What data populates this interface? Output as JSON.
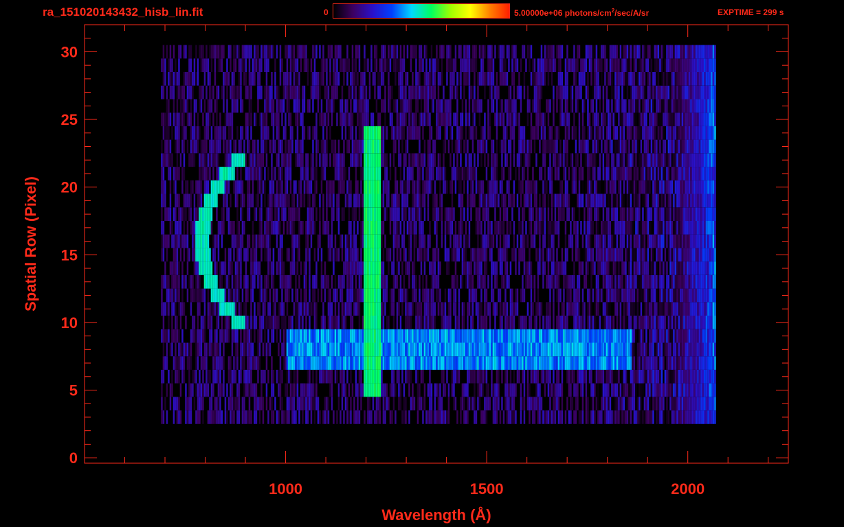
{
  "header": {
    "title": "ra_151020143432_hisb_lin.fit",
    "colorbar_min": "0",
    "colorbar_max_prefix": "5.00000e+06 photons/cm",
    "colorbar_max_exp": "2",
    "colorbar_max_suffix": "/sec/A/sr",
    "exptime": "EXPTIME = 299 s"
  },
  "colors": {
    "axis": "#ff2a1a",
    "background": "#000000",
    "colormap": [
      "#000000",
      "#3c0060",
      "#2a10c8",
      "#0040ff",
      "#00d8ff",
      "#00ff60",
      "#a0ff00",
      "#ffff00",
      "#ff8000",
      "#ff2000"
    ]
  },
  "chart_data": {
    "type": "heatmap",
    "xlabel": "Wavelength (Å)",
    "ylabel": "Spatial Row (Pixel)",
    "xlim": [
      500,
      2250
    ],
    "ylim": [
      -0.4,
      32
    ],
    "xticks": [
      1000,
      1500,
      2000
    ],
    "yticks": [
      0,
      5,
      10,
      15,
      20,
      25,
      30
    ],
    "colorbar_range": [
      0,
      5000000
    ],
    "colorbar_unit": "photons/cm^2/sec/A/sr",
    "detector_coverage": {
      "wavelength": [
        690,
        2070
      ],
      "rows": [
        3,
        30
      ]
    },
    "features": [
      {
        "name": "",
        "type": "emission-line",
        "wavelength": [
          1190,
          1235
        ],
        "rows": [
          5,
          24
        ],
        "level": 0.5
      },
      {
        "name": "",
        "type": "spatial-band",
        "wavelength": [
          1000,
          1860
        ],
        "rows": [
          7,
          9
        ],
        "level": 0.42
      },
      {
        "name": "",
        "type": "arc",
        "wavelength_center": 835,
        "rows": [
          10,
          22
        ],
        "level": 0.46
      },
      {
        "name": "",
        "type": "long-wave-edge",
        "wavelength": [
          1950,
          2070
        ],
        "rows": [
          3,
          30
        ],
        "level": 0.38
      }
    ]
  }
}
